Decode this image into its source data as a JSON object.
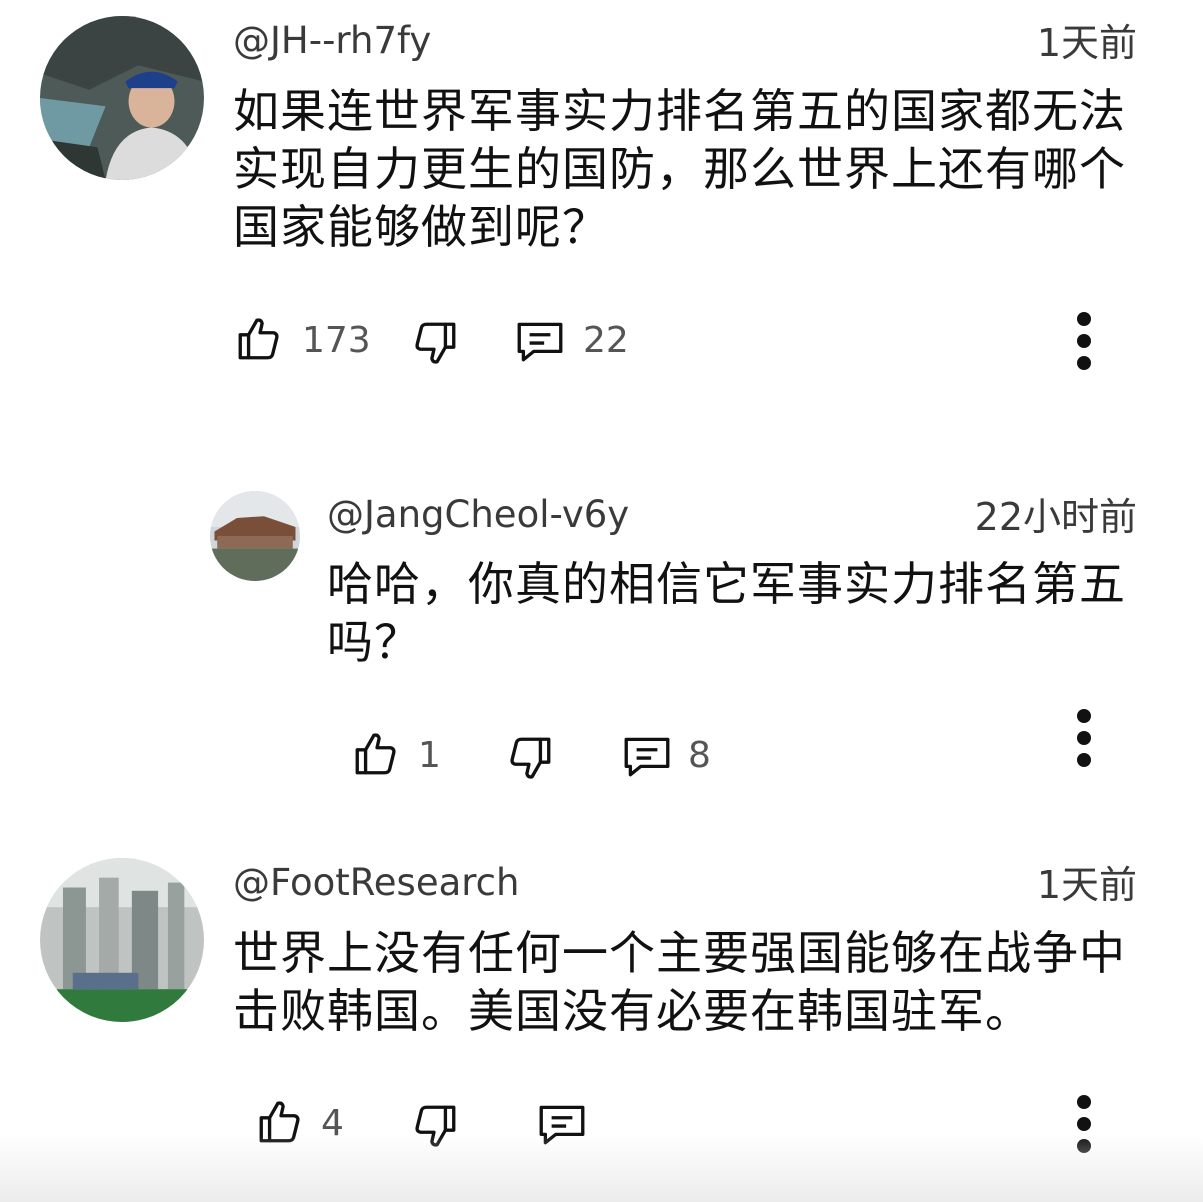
{
  "comments": [
    {
      "handle": "@JH--rh7fy",
      "time": "1天前",
      "text_lines": [
        "如果连世界军事实力排名第五的国家都无法",
        "实现自力更生的国防，那么世界上还有哪个",
        "国家能够做到呢？"
      ],
      "likes": "173",
      "replies": "22"
    },
    {
      "handle": "@JangCheol-v6y",
      "time": "22小时前",
      "text_lines": [
        "哈哈，你真的相信它军事实力排名第五",
        "吗？"
      ],
      "likes": "1",
      "replies": "8"
    },
    {
      "handle": "@FootResearch",
      "time": "1天前",
      "text_lines": [
        "世界上没有任何一个主要强国能够在战争中",
        "击败韩国。美国没有必要在韩国驻军。"
      ],
      "likes": "4"
    }
  ],
  "icons": {
    "like": "thumbs-up-icon",
    "dislike": "thumbs-down-icon",
    "reply": "reply-comment-icon",
    "more": "more-vertical-icon"
  }
}
